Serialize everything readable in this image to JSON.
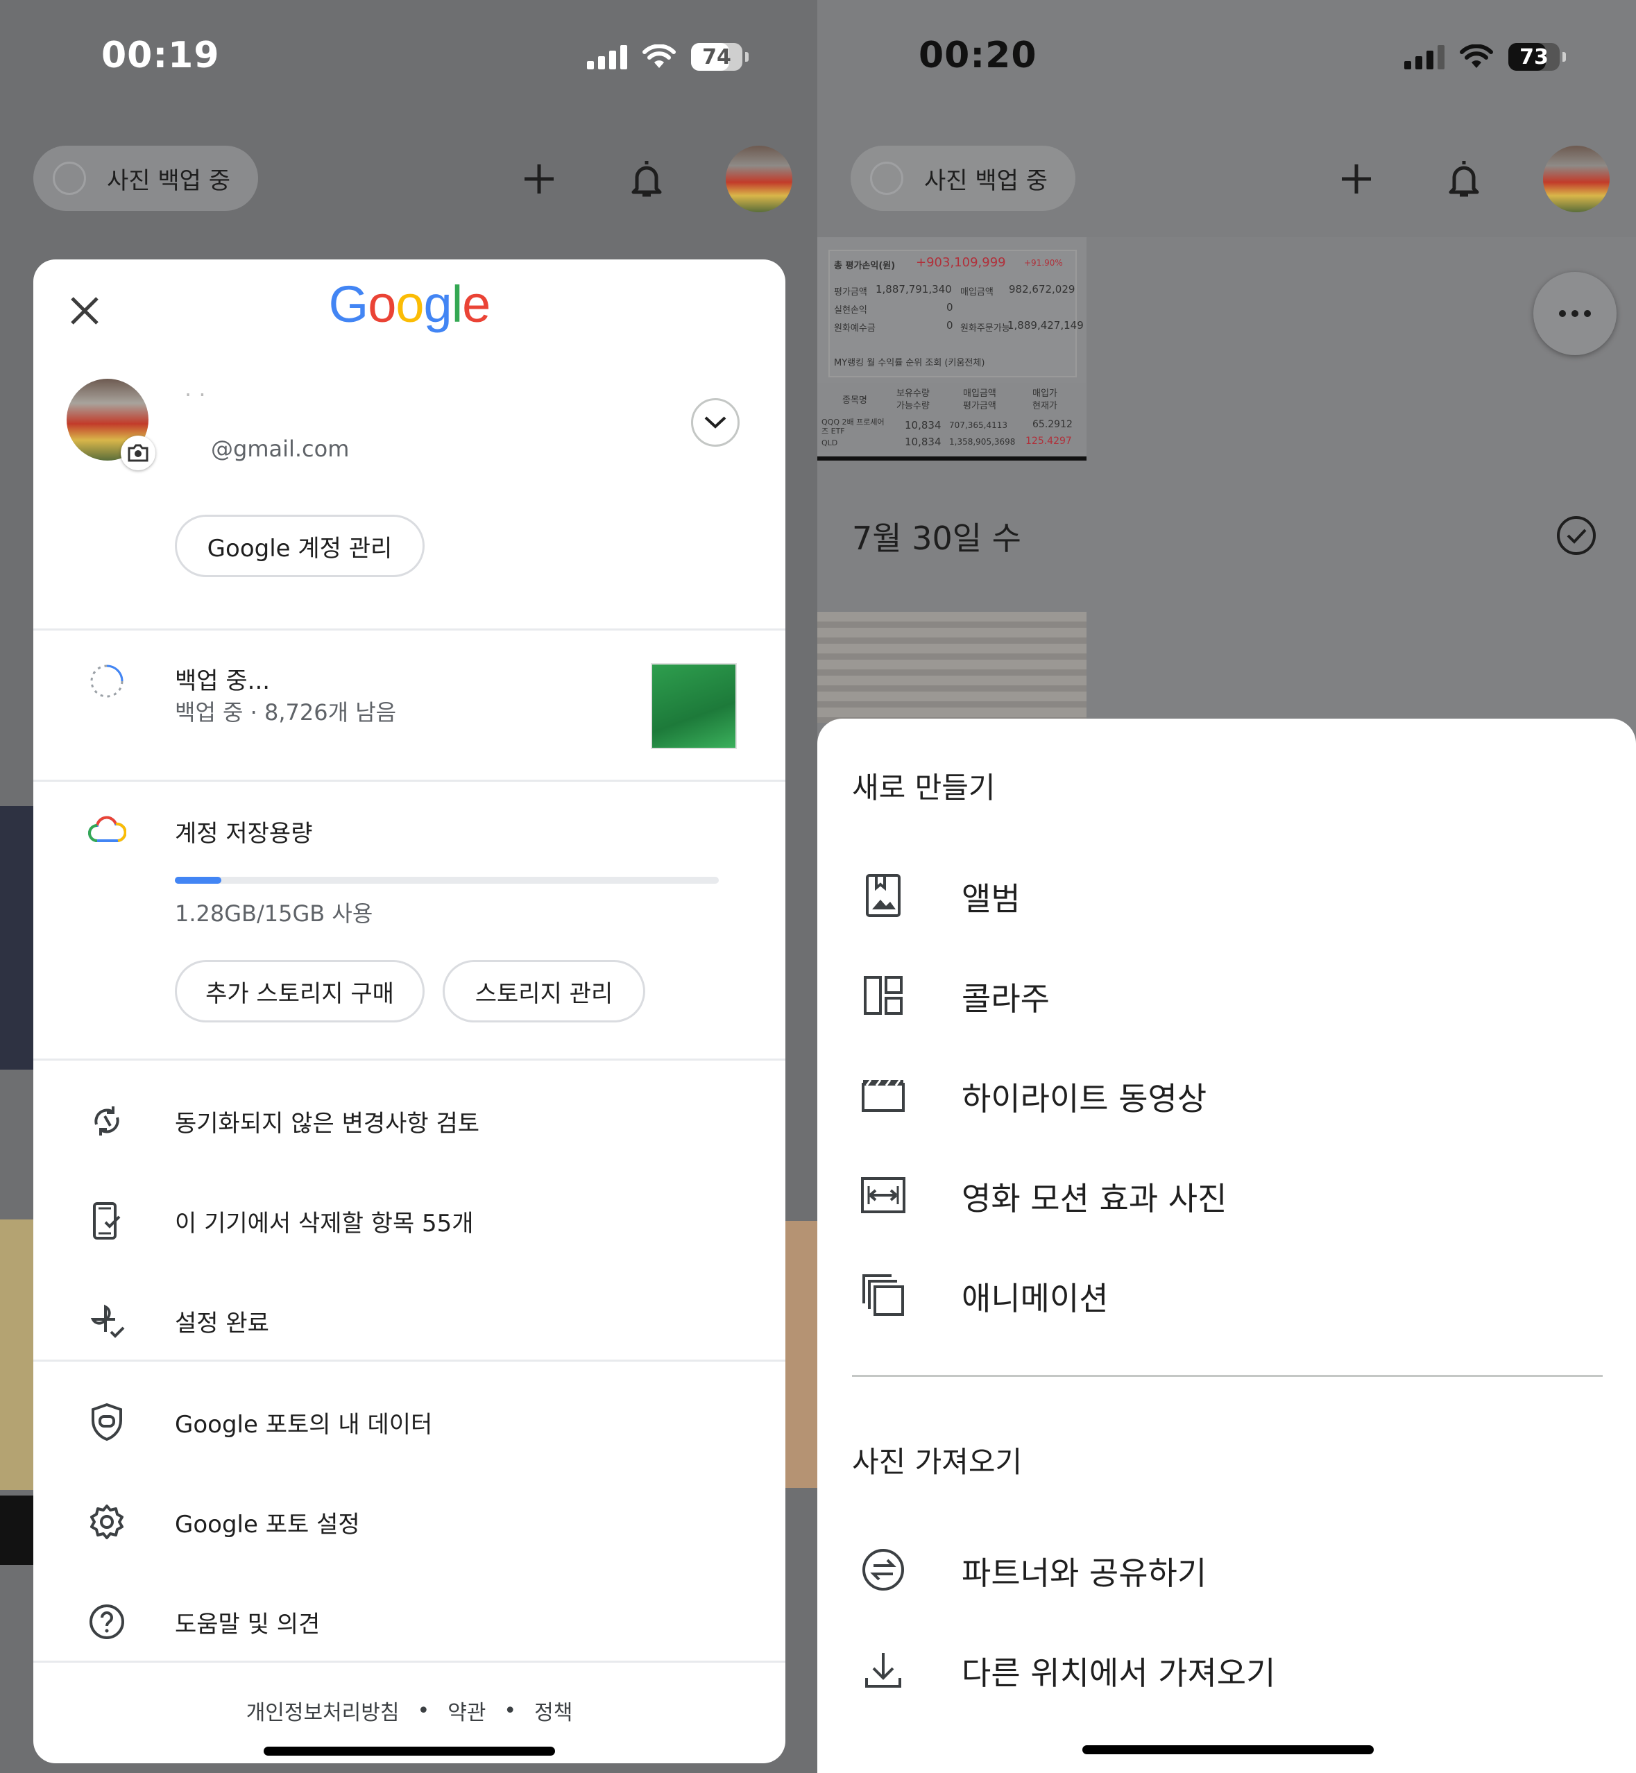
{
  "left": {
    "status": {
      "time": "00:19",
      "battery": "74"
    },
    "topbar": {
      "chip_label": "사진 백업 중"
    },
    "sheet": {
      "brand": "Google",
      "brand_colors": [
        "#4285F4",
        "#EA4335",
        "#FBBC05",
        "#4285F4",
        "#34A853",
        "#EA4335"
      ],
      "account": {
        "name": "· ·",
        "email": "@gmail.com"
      },
      "manage_button": "Google 계정 관리",
      "backup": {
        "title": "백업 중...",
        "subtitle": "백업 중 · 8,726개 남음"
      },
      "storage": {
        "title": "계정 저장용량",
        "used_fraction": 0.085,
        "usage_text": "1.28GB/15GB 사용",
        "buy_button": "추가 스토리지 구매",
        "manage_button": "스토리지 관리"
      },
      "menu": [
        {
          "label": "동기화되지 않은 변경사항 검토",
          "icon": "sync-off-icon"
        },
        {
          "label": "이 기기에서 삭제할 항목 55개",
          "icon": "device-check-icon"
        },
        {
          "label": "설정 완료",
          "icon": "pinwheel-check-icon"
        }
      ],
      "menu2": [
        {
          "label": "Google 포토의 내 데이터",
          "icon": "shield-icon"
        },
        {
          "label": "Google 포토 설정",
          "icon": "gear-icon"
        },
        {
          "label": "도움말 및 의견",
          "icon": "help-icon"
        }
      ],
      "footer": {
        "privacy": "개인정보처리방침",
        "terms": "약관",
        "policy": "정책",
        "sep": "•"
      }
    }
  },
  "right": {
    "status": {
      "time": "00:20",
      "battery": "73"
    },
    "topbar": {
      "chip_label": "사진 백업 중"
    },
    "date_header": "7월 30일 수",
    "screenshot_thumb": {
      "total_label": "총 평가손익(원)",
      "total_value": "+903,109,999",
      "total_pct": "+91.90%",
      "r1a": "평가금액",
      "r1b": "1,887,791,340",
      "r1c": "매입금액",
      "r1d": "982,672,029",
      "r2a": "실현손익",
      "r2b": "0",
      "r3a": "원화예수금",
      "r3b": "0",
      "r3c": "원화주문가능",
      "r3d": "1,889,427,149",
      "r4": "MY랭킹 월 수익률 순위 조회 (키움전체)",
      "h1": "종목명",
      "h2": "보유수량",
      "h3": "매입금액",
      "h4": "매입가",
      "h2b": "가능수량",
      "h3b": "평가금액",
      "h4b": "현재가",
      "s1": "QQQ 2배 프로셰어즈 ETF",
      "s1a": "10,834",
      "s1b": "707,365,4113",
      "s1c": "65.2912",
      "s2": "QLD",
      "s2a": "10,834",
      "s2b": "1,358,905,3698",
      "s2c": "125.4297"
    },
    "create": {
      "section1": "새로 만들기",
      "items": [
        {
          "label": "앨범",
          "icon": "album-icon"
        },
        {
          "label": "콜라주",
          "icon": "collage-icon"
        },
        {
          "label": "하이라이트 동영상",
          "icon": "clapper-icon"
        },
        {
          "label": "영화 모션 효과 사진",
          "icon": "cinematic-icon"
        },
        {
          "label": "애니메이션",
          "icon": "animation-icon"
        }
      ],
      "section2": "사진 가져오기",
      "items2": [
        {
          "label": "파트너와 공유하기",
          "icon": "partner-share-icon"
        },
        {
          "label": "다른 위치에서 가져오기",
          "icon": "import-icon"
        }
      ]
    }
  }
}
